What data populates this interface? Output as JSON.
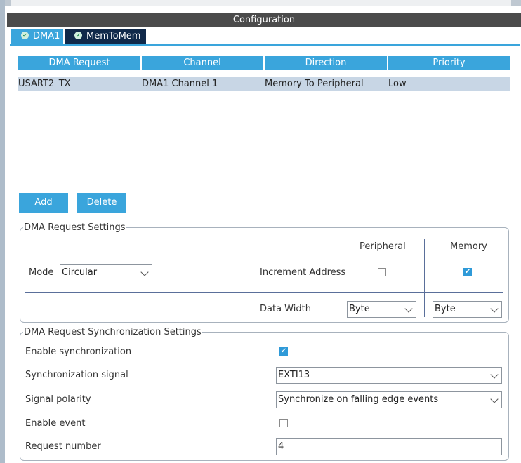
{
  "header": {
    "title": "Configuration"
  },
  "tabs": [
    {
      "label": "DMA1",
      "icon": "check-circle-icon"
    },
    {
      "label": "MemToMem",
      "icon": "check-circle-icon"
    }
  ],
  "table": {
    "columns": [
      "DMA Request",
      "Channel",
      "Direction",
      "Priority"
    ],
    "rows": [
      [
        "USART2_TX",
        "DMA1 Channel 1",
        "Memory To Peripheral",
        "Low"
      ]
    ]
  },
  "buttons": {
    "add": "Add",
    "delete": "Delete"
  },
  "request_settings": {
    "title": "DMA Request Settings",
    "peripheral_label": "Peripheral",
    "memory_label": "Memory",
    "mode_label": "Mode",
    "mode_value": "Circular",
    "increment_label": "Increment Address",
    "peripheral_increment": false,
    "memory_increment": true,
    "data_width_label": "Data Width",
    "peripheral_width": "Byte",
    "memory_width": "Byte"
  },
  "sync_settings": {
    "title": "DMA Request Synchronization Settings",
    "enable_sync_label": "Enable synchronization",
    "enable_sync": true,
    "signal_label": "Synchronization signal",
    "signal_value": "EXTI13",
    "polarity_label": "Signal polarity",
    "polarity_value": "Synchronize on falling edge events",
    "enable_event_label": "Enable event",
    "enable_event": false,
    "request_number_label": "Request number",
    "request_number_value": "4"
  },
  "colors": {
    "accent": "#3aa5dc",
    "tab_dark": "#10294a",
    "header_bg": "#4b4b4b",
    "selected_row": "#c8d6e5"
  }
}
